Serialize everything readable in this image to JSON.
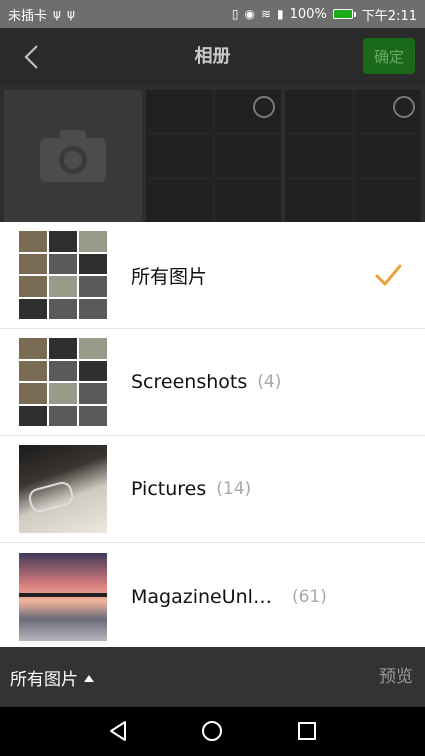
{
  "status_bar": {
    "carrier": "未插卡",
    "battery_percent": "100%",
    "time": "下午2:11",
    "icons": [
      "usb-icon",
      "usb-icon",
      "vibrate-icon",
      "eye-icon",
      "wifi-icon",
      "battery-icon"
    ]
  },
  "app_bar": {
    "title": "相册",
    "confirm_label": "确定"
  },
  "albums": [
    {
      "name": "所有图片",
      "count": "",
      "selected": true
    },
    {
      "name": "Screenshots",
      "count": "(4)",
      "selected": false
    },
    {
      "name": "Pictures",
      "count": "(14)",
      "selected": false
    },
    {
      "name": "MagazineUnl…",
      "count": "(61)",
      "selected": false
    }
  ],
  "bottom_bar": {
    "folder_label": "所有图片",
    "preview_label": "预览"
  },
  "colors": {
    "accent_check": "#e8a23b",
    "confirm_bg": "#1a6a1a",
    "appbar_bg": "#2a2a2a",
    "bottombar_bg": "#333333"
  }
}
